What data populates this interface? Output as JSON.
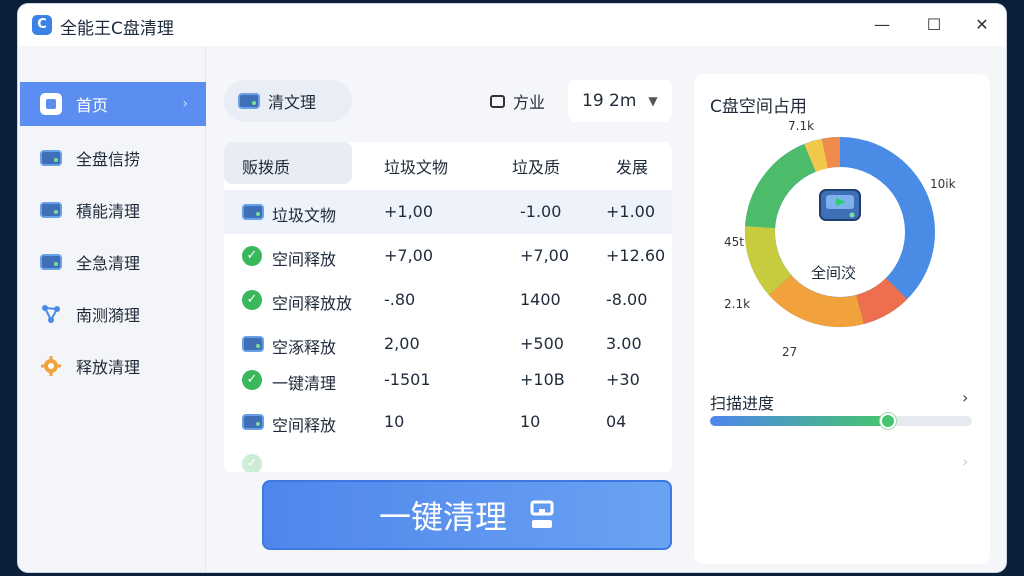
{
  "app": {
    "title": "全能王C盘清理",
    "logo_glyph": "C"
  },
  "window_controls": {
    "minimize": "—",
    "maximize": "☐",
    "close": "✕"
  },
  "sidebar": {
    "items": [
      {
        "label": "首页",
        "icon": "home-icon",
        "active": true
      },
      {
        "label": "全盘信捞",
        "icon": "drive-icon"
      },
      {
        "label": "積能清理",
        "icon": "drive-icon"
      },
      {
        "label": "全急清理",
        "icon": "drive-icon"
      },
      {
        "label": "南测漪理",
        "icon": "network-icon"
      },
      {
        "label": "释放清理",
        "icon": "gear-icon"
      }
    ],
    "active_chevron": "›"
  },
  "main": {
    "pill_label": "清文理",
    "filter_label": "方业",
    "dropdown_value": "19 2m",
    "table": {
      "headers": [
        "贩拨质",
        "垃圾文物",
        "垃及质",
        "发展"
      ],
      "rows": [
        {
          "icon": "drive",
          "name": "垃圾文物",
          "c1": "+1,00",
          "c2": "-1.00",
          "c3": "+1.00",
          "selected": true
        },
        {
          "icon": "check",
          "name": "空间释放",
          "c1": "+7,00",
          "c2": "+7,00",
          "c3": "+12.60"
        },
        {
          "icon": "check",
          "name": "空间释放放",
          "c1": "-.80",
          "c2": "1400",
          "c3": "-8.00"
        },
        {
          "icon": "drive",
          "name": "空涿释放",
          "c1": "2,00",
          "c2": "+500",
          "c3": "3.00"
        },
        {
          "icon": "check",
          "name": "一键清理",
          "c1": "-1501",
          "c2": "+10B",
          "c3": "+30"
        },
        {
          "icon": "drive",
          "name": "空间释放",
          "c1": "10",
          "c2": "10",
          "c3": "04"
        }
      ]
    },
    "clean_button_label": "一键清理"
  },
  "right_panel": {
    "title": "C盘空间占用",
    "center_label": "全间洨",
    "donut_labels": [
      "7.1k",
      "10ik",
      "45t",
      "2.1k",
      "27"
    ],
    "scan_title": "扫描进度",
    "scan_chevron": "›",
    "faint_chevron": "›",
    "scan_progress": 0.68
  },
  "colors": {
    "accent": "#5b8ef0",
    "donut": [
      "#4a8be6",
      "#ee6f4d",
      "#f2a23c",
      "#c6cc3e",
      "#4cbc6a",
      "#f2c84b",
      "#ef8a4a"
    ]
  }
}
